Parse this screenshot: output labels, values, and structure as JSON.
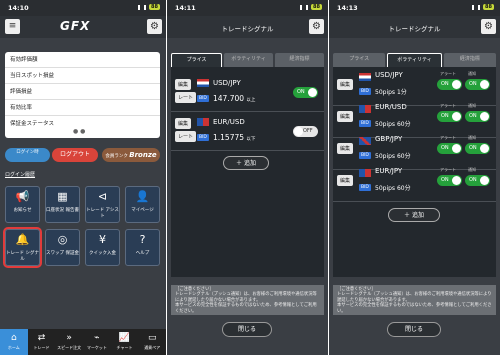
{
  "p1": {
    "time": "14:10",
    "batt": "88",
    "logo": "GFX",
    "rows": [
      "有効評価額",
      "当日スポット損益",
      "評価損益",
      "有効比率",
      "保証金ステータス"
    ],
    "prev": "ログイン時",
    "logout": "ログアウト",
    "rank": "Bronze",
    "rank_label": "会員ランク",
    "hist": "ログイン履歴",
    "icons": [
      "お知らせ",
      "口座状況\n報告書",
      "トレード\nアシスト",
      "マイページ",
      "トレード\nシグナル",
      "スワップ\n保証金",
      "クイック入金",
      "ヘルプ"
    ],
    "tabs": [
      "ホーム",
      "トレード",
      "スピード注文",
      "マーケット",
      "チャート",
      "通貨ペア"
    ]
  },
  "p2": {
    "time": "14:11",
    "batt": "88",
    "title": "トレードシグナル",
    "tabs": [
      "プライス",
      "ボラティリティ",
      "経済指標"
    ],
    "rows": [
      {
        "pair": "USD/JPY",
        "price": "147.700",
        "suffix": "以上",
        "state": "ON"
      },
      {
        "pair": "EUR/USD",
        "price": "1.15775",
        "suffix": "以下",
        "state": "OFF"
      }
    ],
    "rate": "レート",
    "edit": "編集",
    "bid": "BID",
    "add": "追加",
    "close": "閉じる",
    "note": "［ご注意ください］\nトレードシグナル（プッシュ通知）は、お客様のご利用環境や通信状況等により遅延したり届かない場合があります。\n本サービスの完全性を保証するものではないため、参考情報としてご利用ください。"
  },
  "p3": {
    "time": "14:13",
    "batt": "88",
    "title": "トレードシグナル",
    "tabs": [
      "プライス",
      "ボラティリティ",
      "経済指標"
    ],
    "alert": "アラート",
    "notify": "通知",
    "rows": [
      {
        "pair": "USD/JPY",
        "pips": "50pips",
        "period": "1分"
      },
      {
        "pair": "EUR/USD",
        "pips": "50pips",
        "period": "60分"
      },
      {
        "pair": "GBP/JPY",
        "pips": "50pips",
        "period": "60分"
      },
      {
        "pair": "EUR/JPY",
        "pips": "50pips",
        "period": "60分"
      }
    ],
    "on": "ON",
    "add": "追加",
    "close": "閉じる"
  }
}
